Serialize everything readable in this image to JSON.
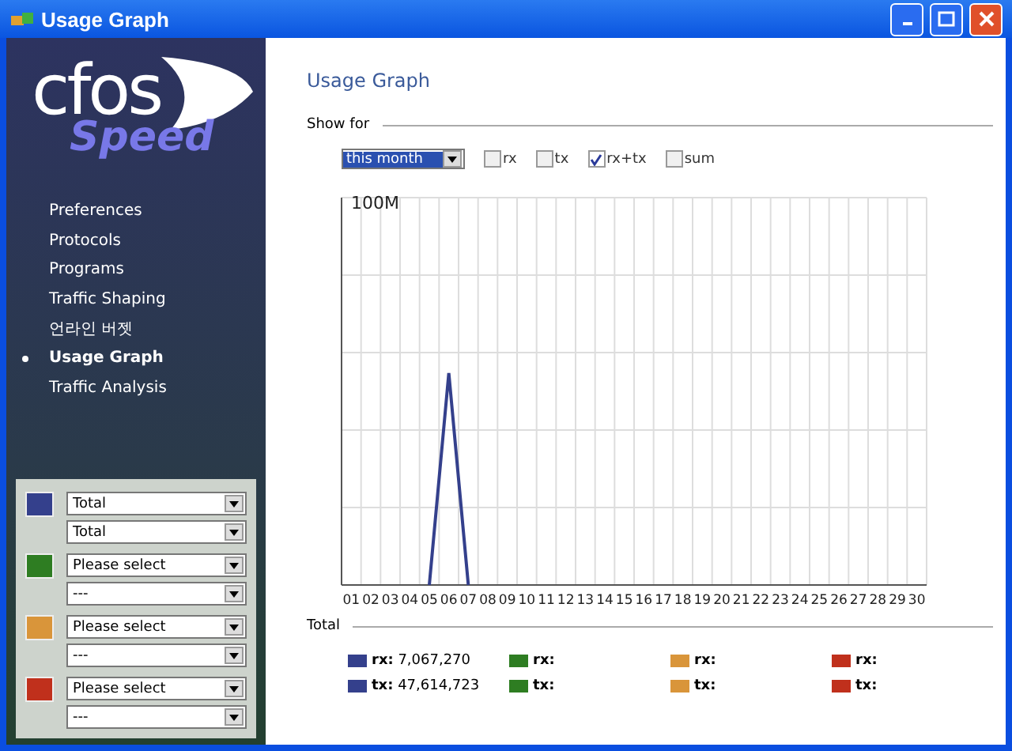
{
  "window": {
    "title": "Usage Graph"
  },
  "logo": {
    "word": "cfos",
    "sub": "Speed"
  },
  "nav": [
    {
      "label": "Preferences",
      "selected": false
    },
    {
      "label": "Protocols",
      "selected": false
    },
    {
      "label": "Programs",
      "selected": false
    },
    {
      "label": "Traffic Shaping",
      "selected": false
    },
    {
      "label": "언라인 버젯",
      "selected": false
    },
    {
      "label": "Usage Graph",
      "selected": true
    },
    {
      "label": "Traffic Analysis",
      "selected": false
    }
  ],
  "series": [
    {
      "color": "#34408c",
      "source": "Total",
      "detail": "Total"
    },
    {
      "color": "#2e7d22",
      "source": "Please select",
      "detail": "---"
    },
    {
      "color": "#d9953a",
      "source": "Please select",
      "detail": "---"
    },
    {
      "color": "#c0301c",
      "source": "Please select",
      "detail": "---"
    }
  ],
  "page_title": "Usage Graph",
  "show_for": {
    "label": "Show for",
    "period": "this month",
    "options": [
      {
        "label": "rx",
        "checked": false
      },
      {
        "label": "tx",
        "checked": false
      },
      {
        "label": "rx+tx",
        "checked": true
      },
      {
        "label": "sum",
        "checked": false
      }
    ]
  },
  "graph": {
    "scale_label": "100M",
    "days": [
      "01",
      "02",
      "03",
      "04",
      "05",
      "06",
      "07",
      "08",
      "09",
      "10",
      "11",
      "12",
      "13",
      "14",
      "15",
      "16",
      "17",
      "18",
      "19",
      "20",
      "21",
      "22",
      "23",
      "24",
      "25",
      "26",
      "27",
      "28",
      "29",
      "30"
    ]
  },
  "total": {
    "label": "Total",
    "items": [
      {
        "color": "#34408c",
        "lines": [
          {
            "label": "rx:",
            "value": "7,067,270"
          },
          {
            "label": "tx:",
            "value": "47,614,723"
          }
        ]
      },
      {
        "color": "#2e7d22",
        "lines": [
          {
            "label": "rx:"
          },
          {
            "label": "tx:"
          }
        ]
      },
      {
        "color": "#d9953a",
        "lines": [
          {
            "label": "rx:"
          },
          {
            "label": "tx:"
          }
        ]
      },
      {
        "color": "#c0301c",
        "lines": [
          {
            "label": "rx:"
          },
          {
            "label": "tx:"
          }
        ]
      }
    ]
  }
}
